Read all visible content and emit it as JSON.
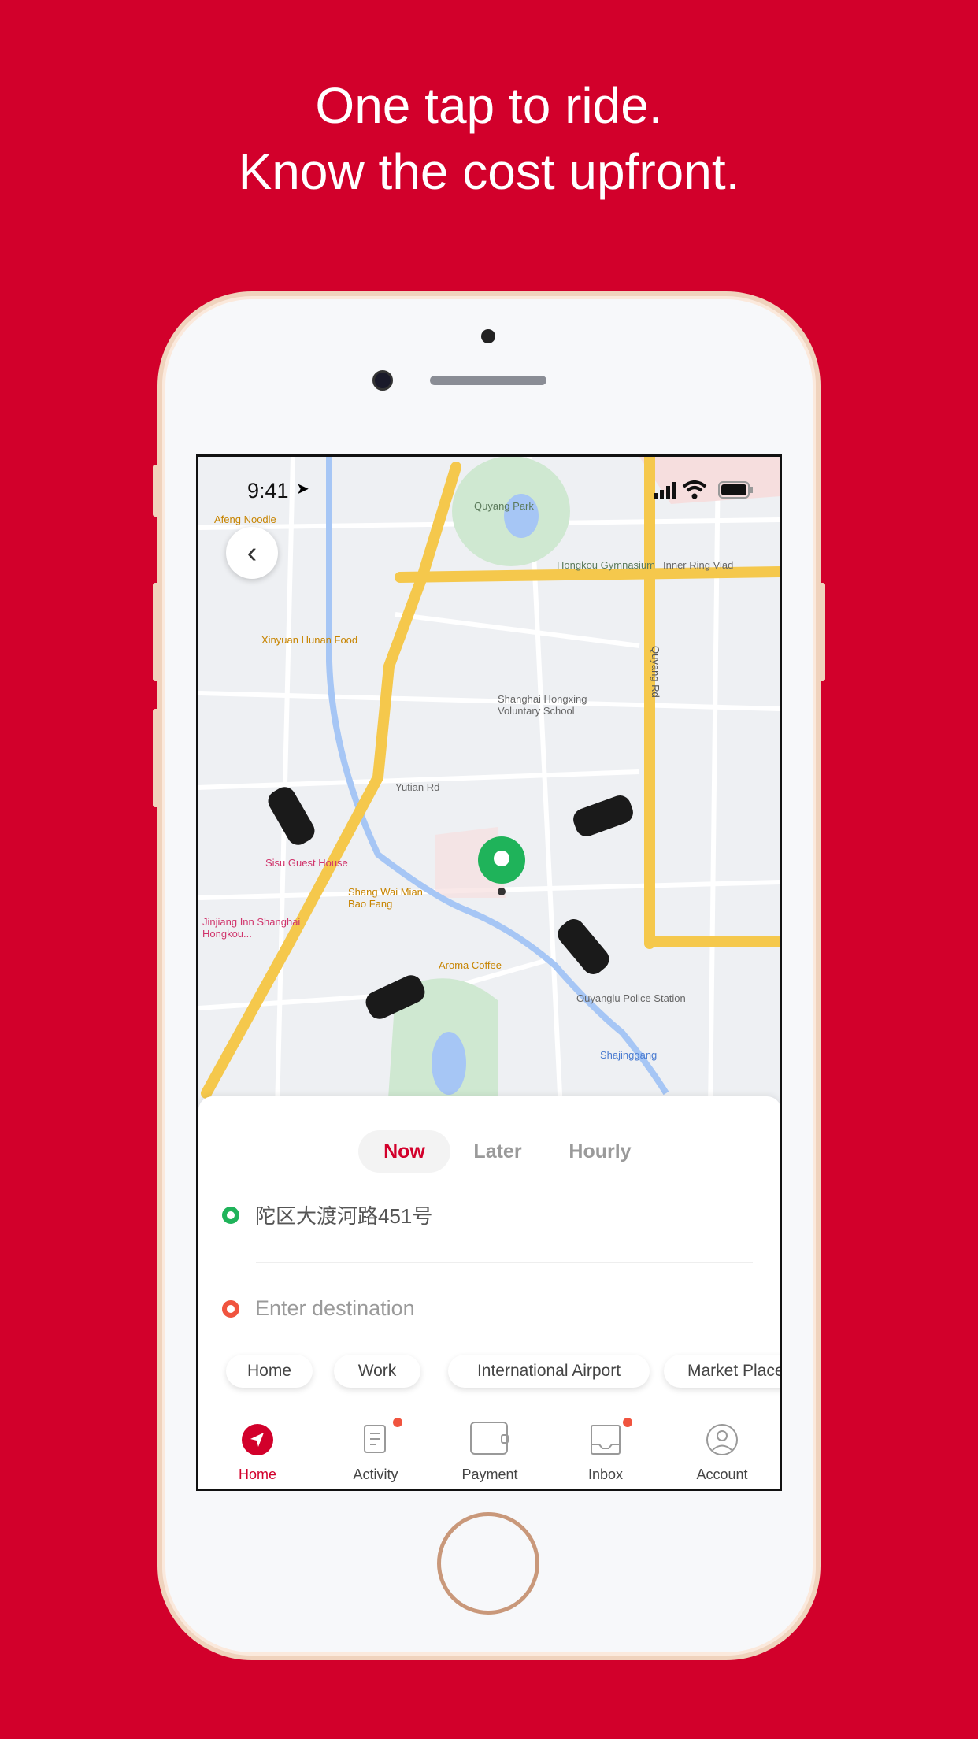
{
  "headline": {
    "line1": "One tap to ride.",
    "line2": "Know the cost upfront."
  },
  "status_bar": {
    "time": "9:41",
    "icons": [
      "location-arrow-icon",
      "signal-icon",
      "wifi-icon",
      "battery-icon"
    ]
  },
  "map": {
    "labels": [
      "Quyang Park",
      "Hongkou Gymnasium",
      "Inner Ring Viad",
      "Xinyuan Hunan Food",
      "Shanghai Hongxing Voluntary School",
      "Sisu Guest House",
      "Shang Wai Mian Bao Fang",
      "Jinjiang Inn Shanghai Hongkou...",
      "Aroma Coffee",
      "Ouyanglu Police Station",
      "Shajinggang",
      "Afeng Noodle",
      "Yutian Rd",
      "Quyang Rd"
    ],
    "pin_color": "#1fb35a",
    "car_count": 4
  },
  "ride_modes": [
    {
      "label": "Now",
      "active": true
    },
    {
      "label": "Later",
      "active": false
    },
    {
      "label": "Hourly",
      "active": false
    }
  ],
  "pickup": {
    "value": "陀区大渡河路451号",
    "color": "#1fb35a"
  },
  "destination": {
    "placeholder": "Enter destination",
    "color": "#f0543f"
  },
  "shortcuts": [
    "Home",
    "Work",
    "International Airport",
    "Market Place"
  ],
  "tabs": [
    {
      "label": "Home",
      "icon": "navigation-icon",
      "active": true,
      "badge": false
    },
    {
      "label": "Activity",
      "icon": "receipt-icon",
      "active": false,
      "badge": true
    },
    {
      "label": "Payment",
      "icon": "wallet-icon",
      "active": false,
      "badge": false
    },
    {
      "label": "Inbox",
      "icon": "inbox-icon",
      "active": false,
      "badge": true
    },
    {
      "label": "Account",
      "icon": "user-icon",
      "active": false,
      "badge": false
    }
  ],
  "colors": {
    "brand": "#d2002b",
    "background": "#d2002b"
  }
}
